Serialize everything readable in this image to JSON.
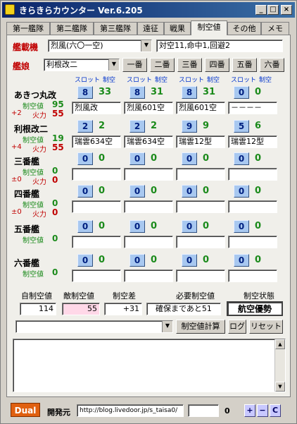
{
  "window": {
    "title": "きらきらカウンター  Ver.6.205",
    "min": "_",
    "max": "□",
    "close": "×"
  },
  "tabs": [
    "第一艦隊",
    "第二艦隊",
    "第三艦隊",
    "遠征",
    "戦果",
    "制空値",
    "その他",
    "メモ"
  ],
  "carrier": {
    "label": "艦載機",
    "selected": "烈風(六〇一空)",
    "info": "対空11,命中1,回避2"
  },
  "ship_select": {
    "label": "艦娘",
    "selected": "利根改二",
    "slot_buttons": [
      "一番",
      "二番",
      "三番",
      "四番",
      "五番",
      "六番"
    ]
  },
  "headers": {
    "slot": "スロット",
    "air": "制空"
  },
  "ships": [
    {
      "name": "あきつ丸改",
      "air_label": "制空値",
      "air_value": "95",
      "bonus": "+2",
      "aa_label": "火力",
      "aa_value": "55",
      "slots": [
        {
          "num": "8",
          "air": "33",
          "plane": "烈風改"
        },
        {
          "num": "8",
          "air": "31",
          "plane": "烈風601空"
        },
        {
          "num": "8",
          "air": "31",
          "plane": "烈風601空"
        },
        {
          "num": "0",
          "air": "0",
          "plane": "－－－－"
        }
      ]
    },
    {
      "name": "利根改二",
      "air_label": "制空値",
      "air_value": "19",
      "bonus": "+4",
      "aa_label": "火力",
      "aa_value": "55",
      "slots": [
        {
          "num": "2",
          "air": "2",
          "plane": "瑞雲634空"
        },
        {
          "num": "2",
          "air": "2",
          "plane": "瑞雲634空"
        },
        {
          "num": "9",
          "air": "9",
          "plane": "瑞雲12型"
        },
        {
          "num": "5",
          "air": "6",
          "plane": "瑞雲12型"
        }
      ]
    },
    {
      "name": "三番艦",
      "air_label": "制空値",
      "air_value": "0",
      "bonus": "±0",
      "aa_label": "火力",
      "aa_value": "0",
      "slots": [
        {
          "num": "0",
          "air": "0",
          "plane": ""
        },
        {
          "num": "0",
          "air": "0",
          "plane": ""
        },
        {
          "num": "0",
          "air": "0",
          "plane": ""
        },
        {
          "num": "0",
          "air": "0",
          "plane": ""
        }
      ]
    },
    {
      "name": "四番艦",
      "air_label": "制空値",
      "air_value": "0",
      "bonus": "±0",
      "aa_label": "火力",
      "aa_value": "0",
      "slots": [
        {
          "num": "0",
          "air": "0",
          "plane": ""
        },
        {
          "num": "0",
          "air": "0",
          "plane": ""
        },
        {
          "num": "0",
          "air": "0",
          "plane": ""
        },
        {
          "num": "0",
          "air": "0",
          "plane": ""
        }
      ]
    },
    {
      "name": "五番艦",
      "air_label": "制空値",
      "air_value": "0",
      "bonus": "",
      "aa_label": "",
      "aa_value": "",
      "slots": [
        {
          "num": "0",
          "air": "0",
          "plane": ""
        },
        {
          "num": "0",
          "air": "0",
          "plane": ""
        },
        {
          "num": "0",
          "air": "0",
          "plane": ""
        },
        {
          "num": "0",
          "air": "0",
          "plane": ""
        }
      ]
    },
    {
      "name": "六番艦",
      "air_label": "制空値",
      "air_value": "0",
      "bonus": "",
      "aa_label": "",
      "aa_value": "",
      "slots": [
        {
          "num": "0",
          "air": "0",
          "plane": ""
        },
        {
          "num": "0",
          "air": "0",
          "plane": ""
        },
        {
          "num": "0",
          "air": "0",
          "plane": ""
        },
        {
          "num": "0",
          "air": "0",
          "plane": ""
        }
      ]
    }
  ],
  "summary": {
    "own_label": "自制空値",
    "own_value": "114",
    "enemy_label": "敵制空値",
    "enemy_value": "55",
    "diff_label": "制空差",
    "diff_value": "+31",
    "need_label": "必要制空値",
    "need_value": "確保まであと51",
    "state_label": "制空状態",
    "state_value": "航空優勢"
  },
  "actions": {
    "calc": "制空値計算",
    "log": "ログ",
    "reset": "リセット"
  },
  "bottom": {
    "dual": "Dual",
    "dev_label": "開発元",
    "url": "http://blog.livedoor.jp/s_taisa0/",
    "count": "0",
    "plus": "+",
    "minus": "−",
    "c": "C"
  }
}
